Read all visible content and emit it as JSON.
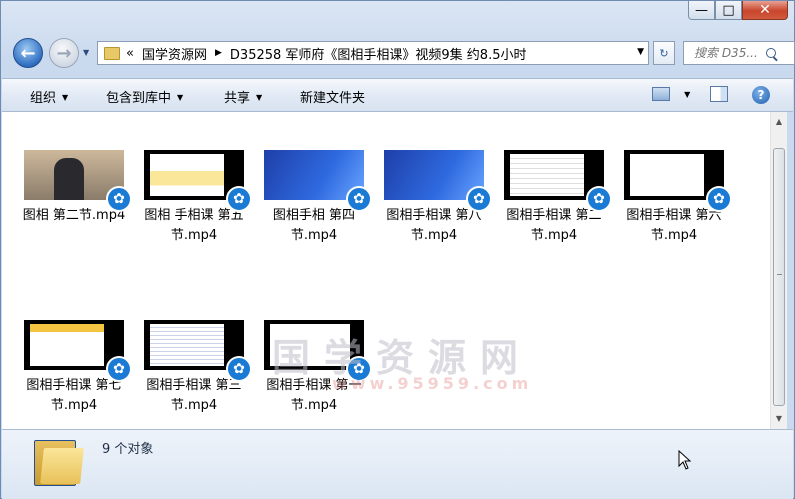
{
  "window": {
    "minimize": "—",
    "maximize": "□",
    "close": "✕"
  },
  "nav": {
    "back": "←",
    "forward": "→"
  },
  "address": {
    "prefix": "«",
    "crumbs": [
      "国学资源网",
      "D35258 军师府《图相手相课》视频9集 约8.5小时"
    ],
    "sep": "▶"
  },
  "search": {
    "placeholder": "搜索 D35..."
  },
  "toolbar": {
    "organize": "组织",
    "include": "包含到库中",
    "share": "共享",
    "newfolder": "新建文件夹"
  },
  "files": [
    {
      "name": "图相 第二节.mp4",
      "thumb": "room"
    },
    {
      "name": "图相 手相课 第五节.mp4",
      "thumb": "yellow"
    },
    {
      "name": "图相手相 第四节.mp4",
      "thumb": "blue"
    },
    {
      "name": "图相手相课 第八节.mp4",
      "thumb": "blue"
    },
    {
      "name": "图相手相课 第二节.mp4",
      "thumb": "text"
    },
    {
      "name": "图相手相课 第六节.mp4",
      "thumb": "hands"
    },
    {
      "name": "图相手相课 第七节.mp4",
      "thumb": "table"
    },
    {
      "name": "图相手相课 第三节.mp4",
      "thumb": "doc"
    },
    {
      "name": "图相手相课 第一节.mp4",
      "thumb": "preface"
    }
  ],
  "status": {
    "count": "9 个对象"
  },
  "watermark": {
    "main": "国学资源网",
    "site": "www.95959.com"
  }
}
